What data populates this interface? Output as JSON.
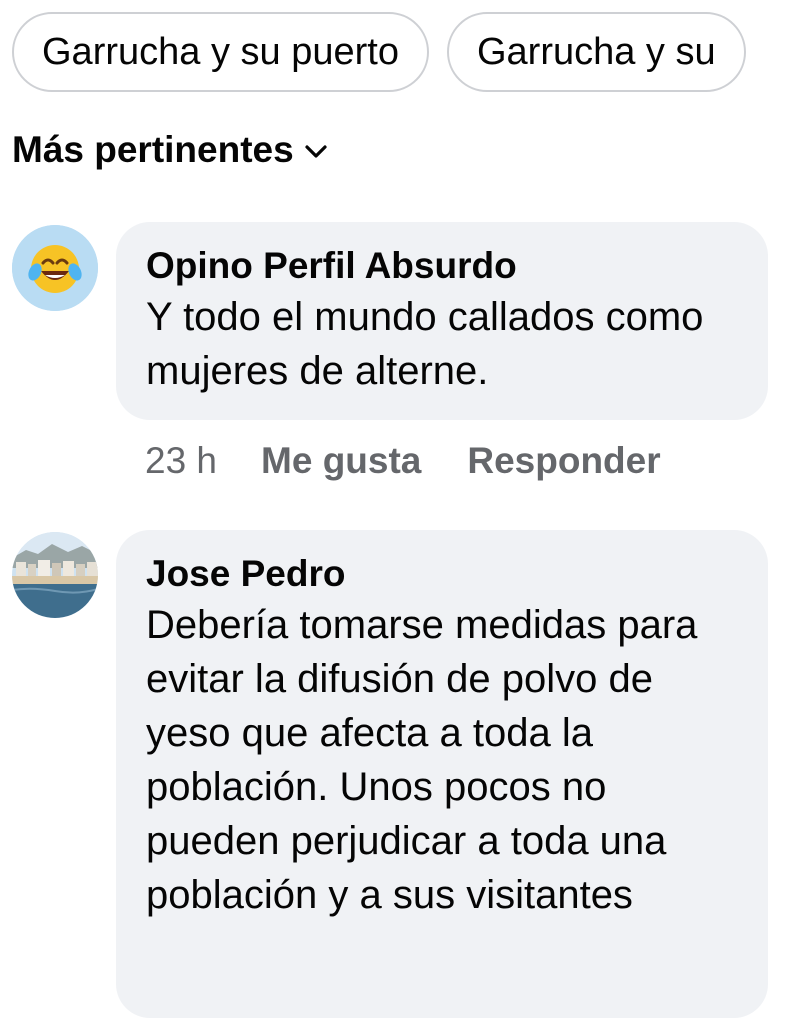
{
  "chips": [
    {
      "label": "Garrucha y su puerto"
    },
    {
      "label": "Garrucha y su"
    }
  ],
  "sort": {
    "label": "Más pertinentes",
    "icon": "chevron-down-icon"
  },
  "comments": [
    {
      "author": "Opino Perfil Absurdo",
      "text": "Y todo el mundo callados como mujeres de alterne.",
      "time": "23 h",
      "like": "Me gusta",
      "reply": "Responder",
      "avatar": "laughing-tears-emoji-avatar"
    },
    {
      "author": "Jose Pedro",
      "text": "Debería tomarse medidas para evitar la difusión de polvo de yeso que afecta a toda la población. Unos pocos no pueden perjudicar a toda una población y a sus visitantes",
      "avatar": "coastal-town-photo-avatar"
    }
  ],
  "colors": {
    "bubble": "#f0f2f5",
    "secondary_text": "#65676b",
    "chip_border": "#ced0d4"
  }
}
